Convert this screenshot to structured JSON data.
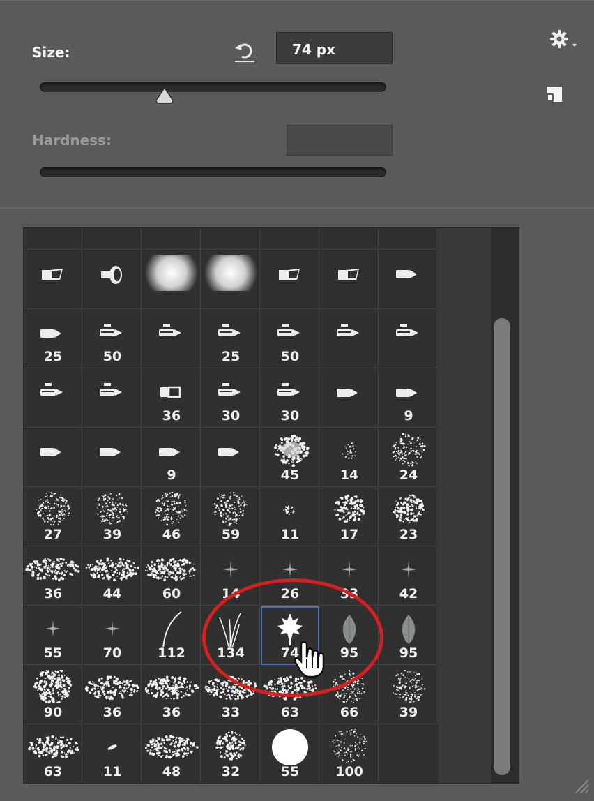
{
  "size": {
    "label": "Size:",
    "value": "74 px",
    "level_fraction": 0.36
  },
  "hardness": {
    "label": "Hardness:",
    "value": ""
  },
  "icons": {
    "reset": "reset-arrow-icon",
    "gear": "gear-menu-icon",
    "panel": "new-preset-icon"
  },
  "annotation_color": "#d62020",
  "selected_index": 46,
  "brushes": [
    {
      "shape": "flat",
      "size": ""
    },
    {
      "shape": "fan",
      "size": ""
    },
    {
      "shape": "soft",
      "size": ""
    },
    {
      "shape": "soft",
      "size": ""
    },
    {
      "shape": "flat",
      "size": ""
    },
    {
      "shape": "flat",
      "size": ""
    },
    {
      "shape": "pencil",
      "size": ""
    },
    {
      "shape": "pencil",
      "size": "25"
    },
    {
      "shape": "stylus",
      "size": "50"
    },
    {
      "shape": "stylus",
      "size": ""
    },
    {
      "shape": "stylus",
      "size": "25"
    },
    {
      "shape": "stylus",
      "size": "50"
    },
    {
      "shape": "stylus",
      "size": ""
    },
    {
      "shape": "stylus",
      "size": ""
    },
    {
      "shape": "stylus",
      "size": ""
    },
    {
      "shape": "stylus",
      "size": ""
    },
    {
      "shape": "block",
      "size": "36"
    },
    {
      "shape": "stylus",
      "size": "30"
    },
    {
      "shape": "stylus",
      "size": "30"
    },
    {
      "shape": "pencil",
      "size": ""
    },
    {
      "shape": "pencil",
      "size": "9"
    },
    {
      "shape": "pencil",
      "size": ""
    },
    {
      "shape": "pencil",
      "size": ""
    },
    {
      "shape": "pencil",
      "size": "9"
    },
    {
      "shape": "pencil",
      "size": ""
    },
    {
      "shape": "cloud",
      "size": "45"
    },
    {
      "shape": "spray-sm",
      "size": "14"
    },
    {
      "shape": "spray",
      "size": "24"
    },
    {
      "shape": "spray",
      "size": "27"
    },
    {
      "shape": "spray",
      "size": "39"
    },
    {
      "shape": "spray",
      "size": "46"
    },
    {
      "shape": "spray",
      "size": "59"
    },
    {
      "shape": "splat-sm",
      "size": "11"
    },
    {
      "shape": "splat",
      "size": "17"
    },
    {
      "shape": "splat",
      "size": "23"
    },
    {
      "shape": "chalk",
      "size": "36"
    },
    {
      "shape": "chalk",
      "size": "44"
    },
    {
      "shape": "chalk",
      "size": "60"
    },
    {
      "shape": "star",
      "size": "14"
    },
    {
      "shape": "star",
      "size": "26"
    },
    {
      "shape": "star",
      "size": "33"
    },
    {
      "shape": "star",
      "size": "42"
    },
    {
      "shape": "star",
      "size": "55"
    },
    {
      "shape": "star",
      "size": "70"
    },
    {
      "shape": "curve",
      "size": "112"
    },
    {
      "shape": "grass",
      "size": "134"
    },
    {
      "shape": "maple",
      "size": "74"
    },
    {
      "shape": "leaf",
      "size": "95"
    },
    {
      "shape": "leaf",
      "size": "95"
    },
    {
      "shape": "texture",
      "size": "90"
    },
    {
      "shape": "chalk",
      "size": "36"
    },
    {
      "shape": "chalk",
      "size": "36"
    },
    {
      "shape": "chalk",
      "size": "33"
    },
    {
      "shape": "chalk",
      "size": "63"
    },
    {
      "shape": "spray",
      "size": "66"
    },
    {
      "shape": "spray",
      "size": "39"
    },
    {
      "shape": "chalk",
      "size": "63"
    },
    {
      "shape": "dash",
      "size": "11"
    },
    {
      "shape": "chalk",
      "size": "48"
    },
    {
      "shape": "splat",
      "size": "32"
    },
    {
      "shape": "hard",
      "size": "55"
    },
    {
      "shape": "dots",
      "size": "100"
    }
  ]
}
